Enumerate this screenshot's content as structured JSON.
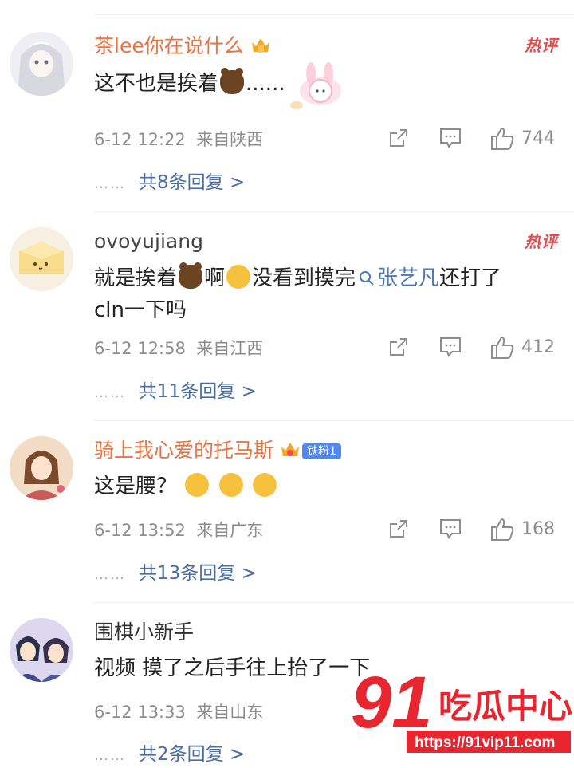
{
  "comments": [
    {
      "username": "茶lee你在说什么",
      "text_before": "这不也是挨着",
      "text_after": "......",
      "hot_label": "热评",
      "time": "6-12 12:22",
      "location": "来自陕西",
      "likes": "744",
      "replies_label": "共8条回复 >"
    },
    {
      "username": "ovoyujiang",
      "text_1": "就是挨着",
      "text_2": "啊",
      "text_3": "没看到摸完",
      "topic": "张艺凡",
      "text_4": "还打了",
      "text_5": "cln一下吗",
      "hot_label": "热评",
      "time": "6-12 12:58",
      "location": "来自江西",
      "likes": "412",
      "replies_label": "共11条回复 >"
    },
    {
      "username": "骑上我心爱的托马斯",
      "fan_badge": "铁粉1",
      "text": "这是腰？",
      "time": "6-12 13:52",
      "location": "来自广东",
      "likes": "168",
      "replies_label": "共13条回复 >"
    },
    {
      "username": "围棋小新手",
      "text": "视频 摸了之后手往上抬了一下",
      "time": "6-12 13:33",
      "location": "来自山东",
      "replies_label": "共2条回复 >"
    }
  ],
  "reply_dots": "……",
  "watermark": {
    "number": "91",
    "brand": "吃瓜中心",
    "url": "https://91vip11.com"
  },
  "colors": {
    "username_orange": "#eb7340",
    "link_blue": "#4a6fa5",
    "hot_red": "#e74b4b",
    "meta_gray": "#8d8d8d"
  }
}
